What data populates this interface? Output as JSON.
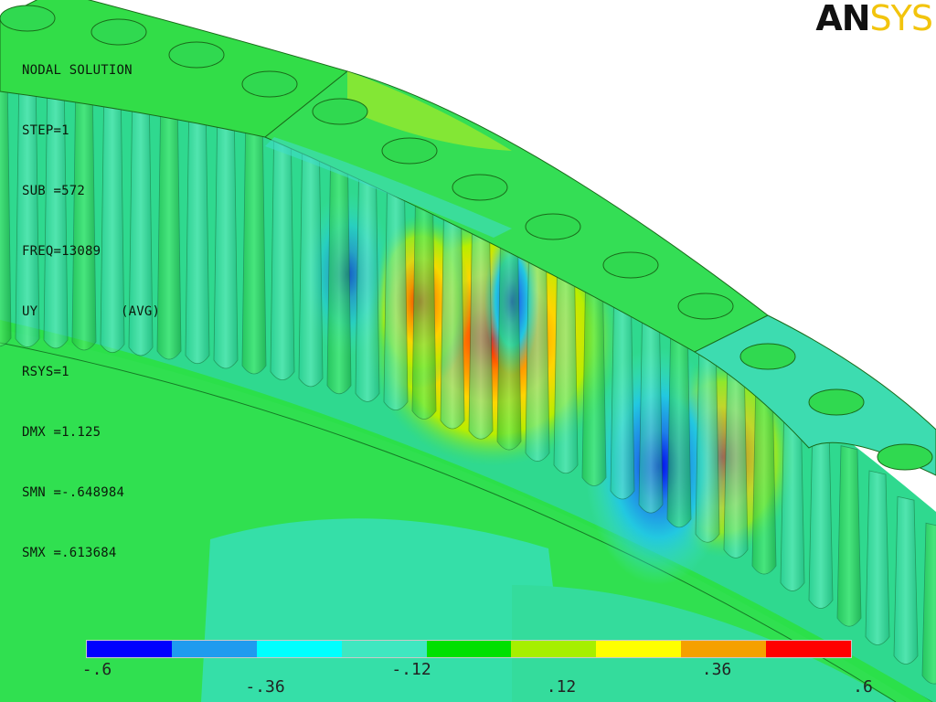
{
  "header": {
    "title": "NODAL SOLUTION",
    "lines": [
      "STEP=1",
      "SUB =572",
      "FREQ=13089",
      "UY",
      "RSYS=1",
      "DMX =1.125",
      "SMN =-.648984",
      "SMX =.613684"
    ],
    "avg_label": "(AVG)"
  },
  "logo": {
    "part1": "AN",
    "part2": "SYS"
  },
  "legend": {
    "colors": [
      "#0000ff",
      "#1f9bef",
      "#00ffff",
      "#3fe7c0",
      "#00e000",
      "#a6ef00",
      "#ffff00",
      "#f5a000",
      "#ff0000"
    ],
    "ticks_bottom": [
      "-.6",
      ".12",
      ".36",
      "-.36",
      "-.12",
      ".12",
      ".36",
      ".6"
    ],
    "ticks_row1": [
      "-.6",
      "-.12",
      ".36"
    ],
    "ticks_row2": [
      "-.36",
      ".12",
      ".6"
    ]
  },
  "colors": {
    "background": "#ffffff",
    "green": "#2ee04f",
    "teal": "#38e0b0",
    "outline": "#1a4a1a"
  }
}
